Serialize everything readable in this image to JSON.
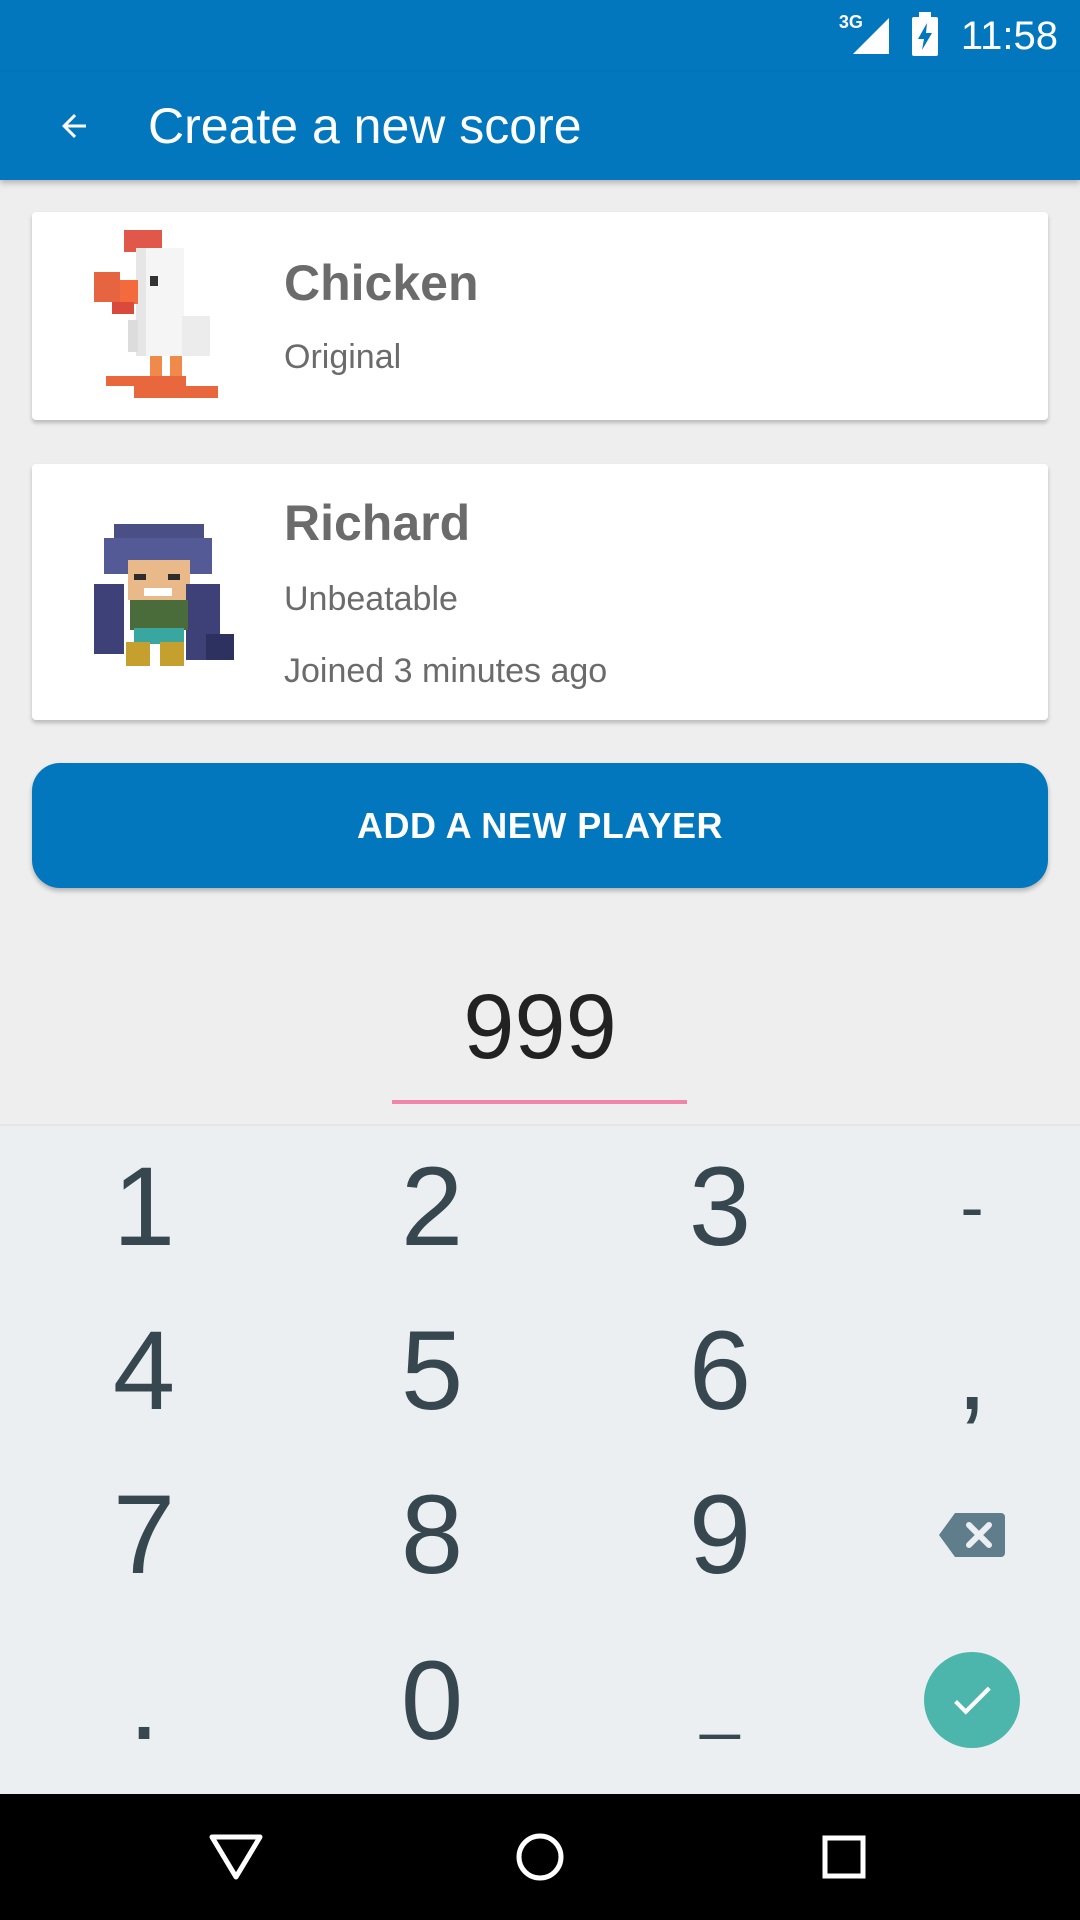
{
  "status_bar": {
    "network": "3G",
    "time": "11:58"
  },
  "app_bar": {
    "title": "Create a new score",
    "back_icon": "arrow-back-icon"
  },
  "players": [
    {
      "name": "Chicken",
      "lines": [
        "Original"
      ]
    },
    {
      "name": "Richard",
      "lines": [
        "Unbeatable",
        "Joined 3 minutes ago"
      ]
    }
  ],
  "add_player_button": "ADD A NEW PLAYER",
  "score_input": {
    "value": "999"
  },
  "keypad": {
    "rows": [
      [
        "1",
        "2",
        "3",
        "-"
      ],
      [
        "4",
        "5",
        "6",
        ","
      ],
      [
        "7",
        "8",
        "9",
        "backspace-icon"
      ],
      [
        ".",
        "0",
        "_",
        "done-icon"
      ]
    ]
  },
  "colors": {
    "primary": "#0277bd",
    "accent": "#4db6ac",
    "underline": "#f06292"
  }
}
